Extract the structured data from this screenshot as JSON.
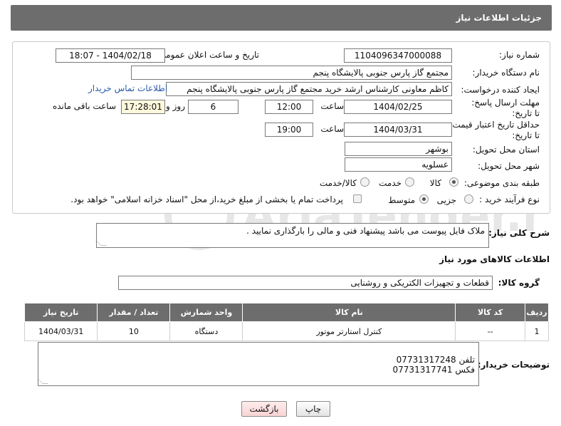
{
  "header": {
    "title": "جزئیات اطلاعات نیاز"
  },
  "fields": {
    "need_number_label": "شماره نیاز:",
    "need_number": "1104096347000088",
    "announce_label": "تاریخ و ساعت اعلان عمومی:",
    "announce_value": "1404/02/18 - 18:07",
    "buyer_org_label": "نام دستگاه خریدار:",
    "buyer_org": "مجتمع گاز پارس جنوبی  پالایشگاه پنجم",
    "creator_label": "ایجاد کننده درخواست:",
    "creator": "کاظم معاونی کارشناس ارشد خرید مجتمع گاز پارس جنوبی  پالایشگاه پنجم",
    "contact_link": "اطلاعات تماس خریدار",
    "deadline_label": "مهلت ارسال پاسخ: تا تاریخ:",
    "deadline_date": "1404/02/25",
    "time_label": "ساعت",
    "deadline_time": "12:00",
    "days_value": "6",
    "days_label": "روز و",
    "remaining_time": "17:28:01",
    "remaining_label": "ساعت باقی مانده",
    "min_price_label": "حداقل تاریخ اعتبار قیمت: تا تاریخ:",
    "min_price_date": "1404/03/31",
    "min_price_time": "19:00",
    "province_label": "استان محل تحویل:",
    "province": "بوشهر",
    "city_label": "شهر محل تحویل:",
    "city": "عسلویه",
    "category_label": "طبقه بندی موضوعی:",
    "category_options": [
      "کالا",
      "خدمت",
      "کالا/خدمت"
    ],
    "process_label": "نوع فرآیند خرید :",
    "process_options": [
      "جزیی",
      "متوسط"
    ],
    "payment_note": "پرداخت تمام یا بخشی از مبلغ خرید،از محل \"اسناد خزانه اسلامی\" خواهد بود.",
    "general_desc_label": "شرح کلی نیاز:",
    "general_desc": "ملاک فایل پیوست می باشد پیشنهاد فنی و مالی را بارگذاری نمایید .",
    "goods_info_title": "اطلاعات کالاهای مورد نیاز",
    "goods_group_label": "گروه کالا:",
    "goods_group": "قطعات و تجهیزات الکتریکی و روشنایی",
    "buyer_notes_label": "توضیحات خریدار:",
    "buyer_notes": "تلفن 07731317248\nفکس 07731317741"
  },
  "table": {
    "headers": [
      "ردیف",
      "کد کالا",
      "نام کالا",
      "واحد شمارش",
      "تعداد / مقدار",
      "تاریخ نیاز"
    ],
    "rows": [
      [
        "1",
        "--",
        "کنترل استارتر موتور",
        "دستگاه",
        "10",
        "1404/03/31"
      ]
    ]
  },
  "buttons": {
    "print": "چاپ",
    "back": "بازگشت"
  },
  "watermark": "AriaTender.net"
}
